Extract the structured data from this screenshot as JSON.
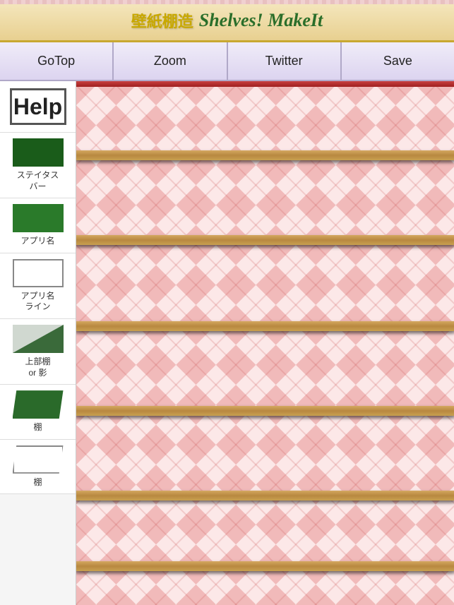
{
  "titleBar": {
    "japanese": "壁紙棚造",
    "english": "Shelves! MakeIt"
  },
  "toolbar": {
    "buttons": [
      {
        "id": "gotop",
        "label": "GoTop"
      },
      {
        "id": "zoom",
        "label": "Zoom"
      },
      {
        "id": "twitter",
        "label": "Twitter"
      },
      {
        "id": "save",
        "label": "Save"
      }
    ]
  },
  "sidebar": {
    "items": [
      {
        "id": "help",
        "label": "Help",
        "type": "help"
      },
      {
        "id": "status-bar",
        "label": "ステイタス\nバー",
        "type": "dark-green"
      },
      {
        "id": "app-name",
        "label": "アプリ名",
        "type": "green"
      },
      {
        "id": "app-name-line",
        "label": "アプリ名\nライン",
        "type": "outline"
      },
      {
        "id": "top-shelf-shadow",
        "label": "上部棚\nor 影",
        "type": "shadow"
      },
      {
        "id": "shelf1",
        "label": "棚",
        "type": "shelf"
      },
      {
        "id": "shelf2",
        "label": "棚",
        "type": "shelf-outline"
      }
    ]
  },
  "preview": {
    "shelfColor": "#d4a860",
    "shelfTopColor": "#c84040",
    "shelfPositions": [
      0,
      19,
      31,
      50,
      62,
      81,
      87
    ]
  },
  "colors": {
    "titleBg": "#f5e8c0",
    "toolbarBg": "#e8e0f0",
    "accent": "#c8a800",
    "green": "#2a6e2a"
  }
}
